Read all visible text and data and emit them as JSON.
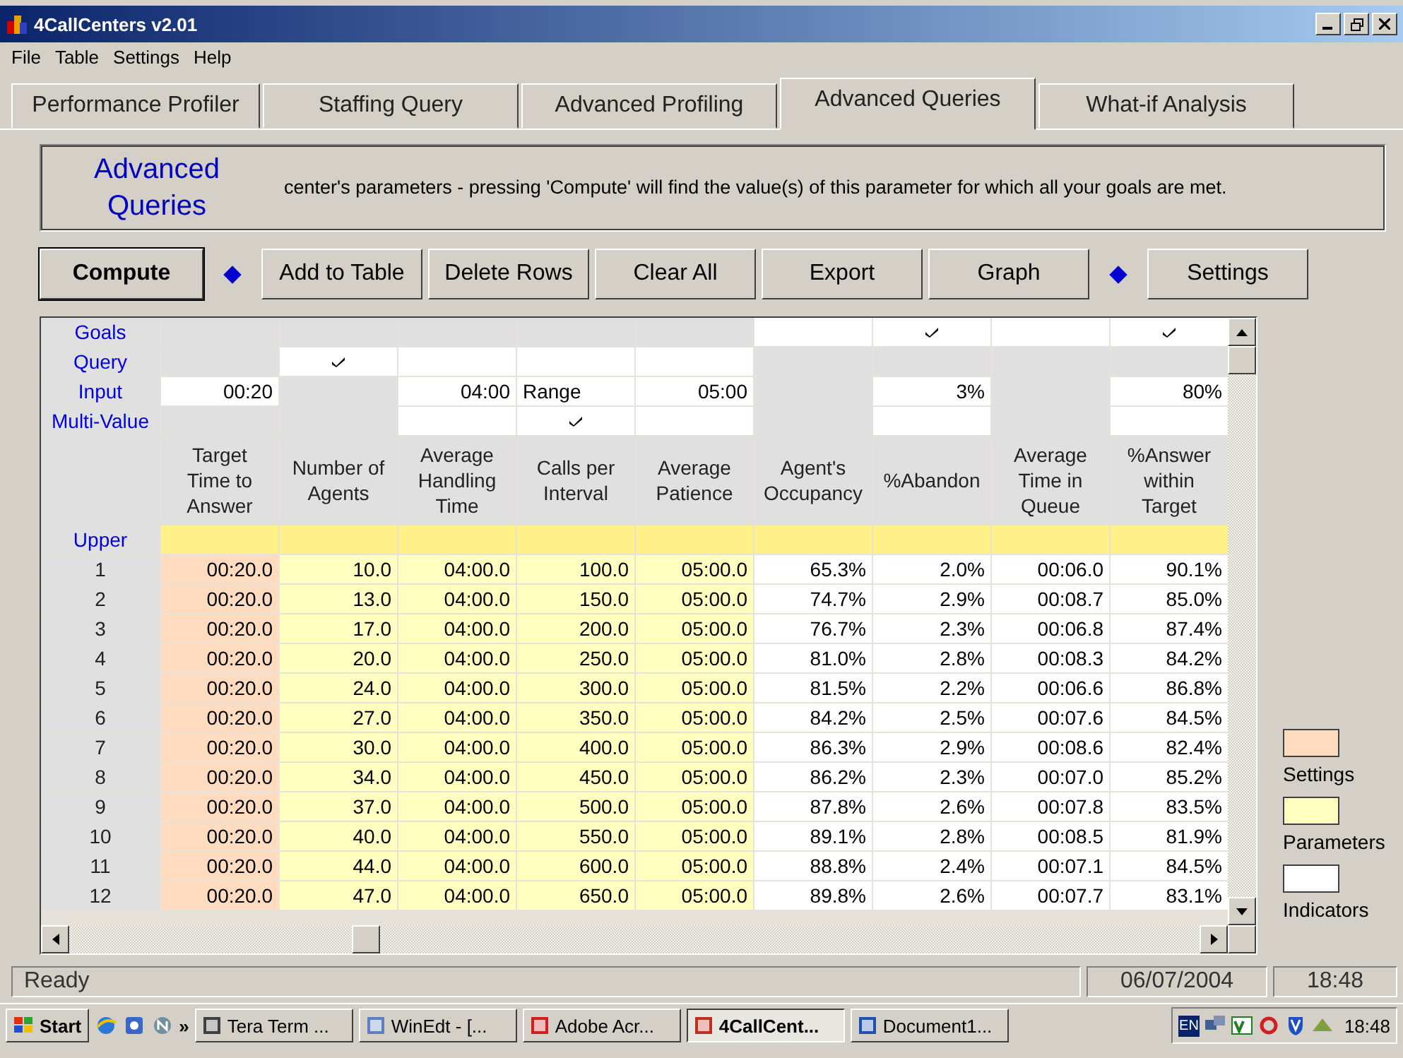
{
  "window": {
    "title": "4CallCenters v2.01"
  },
  "menu": [
    "File",
    "Table",
    "Settings",
    "Help"
  ],
  "tabs": [
    {
      "label": "Performance Profiler",
      "selected": false
    },
    {
      "label": "Staffing Query",
      "selected": false
    },
    {
      "label": "Advanced Profiling",
      "selected": false
    },
    {
      "label": "Advanced Queries",
      "selected": true
    },
    {
      "label": "What-if Analysis",
      "selected": false
    }
  ],
  "intro": {
    "title": "Advanced Queries",
    "text": "center's parameters - pressing 'Compute' will find the value(s) of this parameter for which all your goals are met."
  },
  "toolbar": [
    {
      "kind": "button",
      "label": "Compute",
      "default": true
    },
    {
      "kind": "diamond"
    },
    {
      "kind": "button",
      "label": "Add to Table",
      "default": false
    },
    {
      "kind": "button",
      "label": "Delete Rows",
      "default": false
    },
    {
      "kind": "button",
      "label": "Clear All",
      "default": false
    },
    {
      "kind": "button",
      "label": "Export",
      "default": false
    },
    {
      "kind": "button",
      "label": "Graph",
      "default": false
    },
    {
      "kind": "diamond"
    },
    {
      "kind": "button",
      "label": "Settings",
      "default": false
    }
  ],
  "table": {
    "control_rows": [
      {
        "label": "Goals",
        "cells": [
          {
            "editable": false,
            "checked": false
          },
          {
            "editable": false,
            "checked": false
          },
          {
            "editable": false,
            "checked": false
          },
          {
            "editable": false,
            "checked": false
          },
          {
            "editable": false,
            "checked": false
          },
          {
            "editable": true,
            "checked": false
          },
          {
            "editable": true,
            "checked": true
          },
          {
            "editable": true,
            "checked": false
          },
          {
            "editable": true,
            "checked": true
          }
        ]
      },
      {
        "label": "Query",
        "cells": [
          {
            "editable": false,
            "checked": false
          },
          {
            "editable": true,
            "checked": true
          },
          {
            "editable": true,
            "checked": false
          },
          {
            "editable": true,
            "checked": false
          },
          {
            "editable": true,
            "checked": false
          },
          {
            "editable": false,
            "checked": false
          },
          {
            "editable": false,
            "checked": false
          },
          {
            "editable": false,
            "checked": false
          },
          {
            "editable": false,
            "checked": false
          }
        ]
      },
      {
        "label": "Input",
        "cells": [
          {
            "editable": true,
            "checked": false,
            "value": "00:20"
          },
          {
            "editable": false,
            "checked": false
          },
          {
            "editable": true,
            "checked": false,
            "value": "04:00"
          },
          {
            "editable": true,
            "checked": false,
            "value": "Range",
            "kind": "choice"
          },
          {
            "editable": true,
            "checked": false,
            "value": "05:00"
          },
          {
            "editable": false,
            "checked": false
          },
          {
            "editable": true,
            "checked": false,
            "value": "3%"
          },
          {
            "editable": false,
            "checked": false
          },
          {
            "editable": true,
            "checked": false,
            "value": "80%"
          }
        ]
      },
      {
        "label": "Multi-Value",
        "cells": [
          {
            "editable": false,
            "checked": false
          },
          {
            "editable": false,
            "checked": false
          },
          {
            "editable": true,
            "checked": false
          },
          {
            "editable": true,
            "checked": true
          },
          {
            "editable": true,
            "checked": false
          },
          {
            "editable": false,
            "checked": false
          },
          {
            "editable": true,
            "checked": false
          },
          {
            "editable": false,
            "checked": false
          },
          {
            "editable": true,
            "checked": false
          }
        ]
      }
    ],
    "columns": [
      {
        "header": "Target Time to Answer",
        "kind": "settings"
      },
      {
        "header": "Number of Agents",
        "kind": "parameters"
      },
      {
        "header": "Average Handling Time",
        "kind": "parameters"
      },
      {
        "header": "Calls per Interval",
        "kind": "parameters"
      },
      {
        "header": "Average Patience",
        "kind": "parameters"
      },
      {
        "header": "Agent's Occupancy",
        "kind": "indicators"
      },
      {
        "header": "%Abandon",
        "kind": "indicators"
      },
      {
        "header": "Average Time in Queue",
        "kind": "indicators"
      },
      {
        "header": "%Answer within Target",
        "kind": "indicators"
      }
    ],
    "upper_label": "Upper",
    "rows": [
      {
        "index": "1",
        "cells": [
          "00:20.0",
          "10.0",
          "04:00.0",
          "100.0",
          "05:00.0",
          "65.3%",
          "2.0%",
          "00:06.0",
          "90.1%"
        ]
      },
      {
        "index": "2",
        "cells": [
          "00:20.0",
          "13.0",
          "04:00.0",
          "150.0",
          "05:00.0",
          "74.7%",
          "2.9%",
          "00:08.7",
          "85.0%"
        ]
      },
      {
        "index": "3",
        "cells": [
          "00:20.0",
          "17.0",
          "04:00.0",
          "200.0",
          "05:00.0",
          "76.7%",
          "2.3%",
          "00:06.8",
          "87.4%"
        ]
      },
      {
        "index": "4",
        "cells": [
          "00:20.0",
          "20.0",
          "04:00.0",
          "250.0",
          "05:00.0",
          "81.0%",
          "2.8%",
          "00:08.3",
          "84.2%"
        ]
      },
      {
        "index": "5",
        "cells": [
          "00:20.0",
          "24.0",
          "04:00.0",
          "300.0",
          "05:00.0",
          "81.5%",
          "2.2%",
          "00:06.6",
          "86.8%"
        ]
      },
      {
        "index": "6",
        "cells": [
          "00:20.0",
          "27.0",
          "04:00.0",
          "350.0",
          "05:00.0",
          "84.2%",
          "2.5%",
          "00:07.6",
          "84.5%"
        ]
      },
      {
        "index": "7",
        "cells": [
          "00:20.0",
          "30.0",
          "04:00.0",
          "400.0",
          "05:00.0",
          "86.3%",
          "2.9%",
          "00:08.6",
          "82.4%"
        ]
      },
      {
        "index": "8",
        "cells": [
          "00:20.0",
          "34.0",
          "04:00.0",
          "450.0",
          "05:00.0",
          "86.2%",
          "2.3%",
          "00:07.0",
          "85.2%"
        ]
      },
      {
        "index": "9",
        "cells": [
          "00:20.0",
          "37.0",
          "04:00.0",
          "500.0",
          "05:00.0",
          "87.8%",
          "2.6%",
          "00:07.8",
          "83.5%"
        ]
      },
      {
        "index": "10",
        "cells": [
          "00:20.0",
          "40.0",
          "04:00.0",
          "550.0",
          "05:00.0",
          "89.1%",
          "2.8%",
          "00:08.5",
          "81.9%"
        ]
      },
      {
        "index": "11",
        "cells": [
          "00:20.0",
          "44.0",
          "04:00.0",
          "600.0",
          "05:00.0",
          "88.8%",
          "2.4%",
          "00:07.1",
          "84.5%"
        ]
      },
      {
        "index": "12",
        "cells": [
          "00:20.0",
          "47.0",
          "04:00.0",
          "650.0",
          "05:00.0",
          "89.8%",
          "2.6%",
          "00:07.7",
          "83.1%"
        ]
      }
    ]
  },
  "legend": [
    {
      "label": "Settings",
      "color": "#ffdcc0"
    },
    {
      "label": "Parameters",
      "color": "#ffffc0"
    },
    {
      "label": "Indicators",
      "color": "#ffffff"
    }
  ],
  "status_bar": {
    "message": "Ready",
    "date": "06/07/2004",
    "time": "18:48"
  },
  "taskbar": {
    "start": "Start",
    "more": "»",
    "tasks": [
      {
        "label": "Tera Term ...",
        "selected": false
      },
      {
        "label": "WinEdt  - [...",
        "selected": false
      },
      {
        "label": "Adobe Acr...",
        "selected": false
      },
      {
        "label": "4CallCent...",
        "selected": true
      },
      {
        "label": "Document1...",
        "selected": false
      }
    ],
    "language": "EN",
    "clock": "18:48"
  }
}
